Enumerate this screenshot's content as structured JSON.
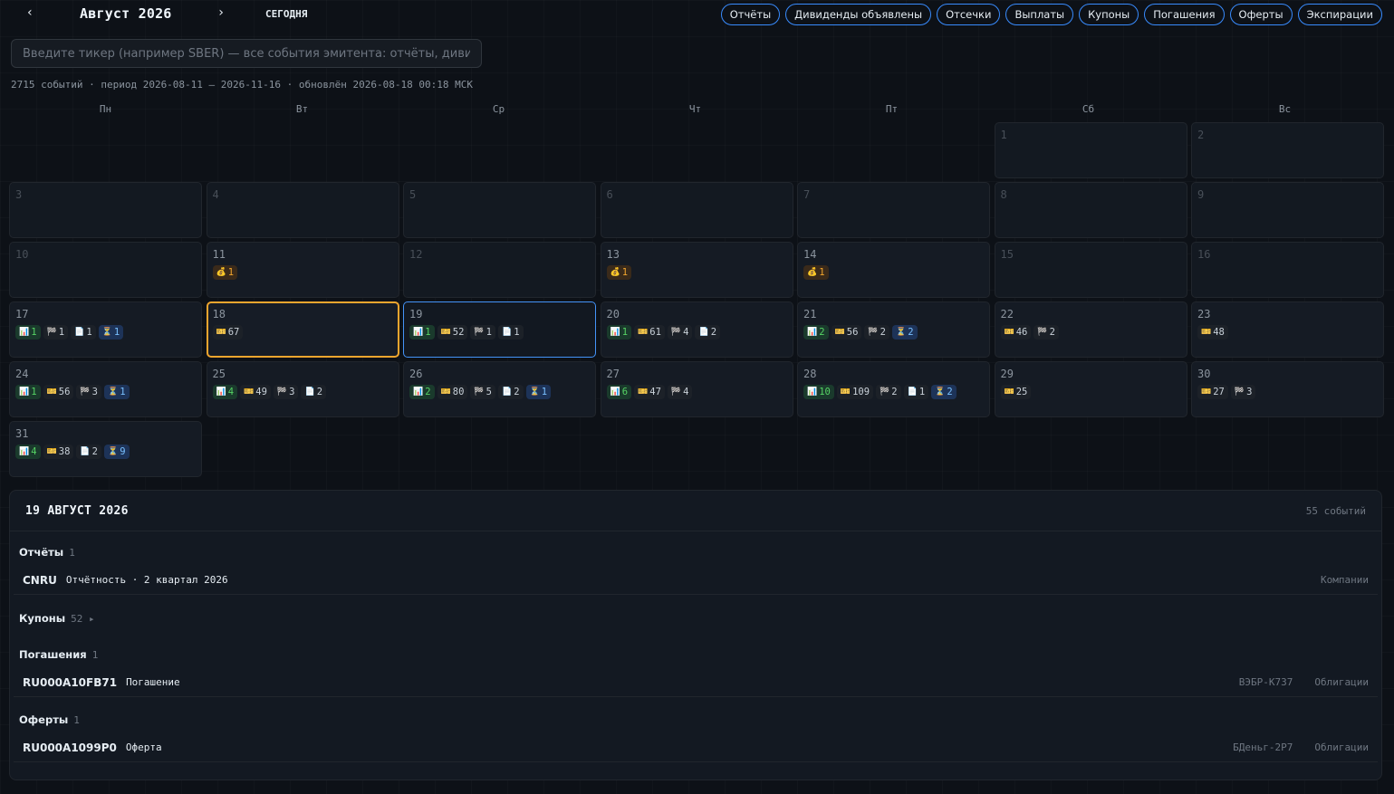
{
  "header": {
    "prev": "‹",
    "next": "›",
    "month": "Август 2026",
    "today": "СЕГОДНЯ"
  },
  "filters": [
    "Отчёты",
    "Дивиденды объявлены",
    "Отсечки",
    "Выплаты",
    "Купоны",
    "Погашения",
    "Оферты",
    "Экспирации"
  ],
  "search": {
    "placeholder": "Введите тикер (например SBER) — все события эмитента: отчёты, дивиденды, купоны",
    "value": ""
  },
  "meta": "2715 событий · период 2026-08-11 — 2026-11-16 · обновлён 2026-08-18 00:18 МСК",
  "weekdays": [
    "Пн",
    "Вт",
    "Ср",
    "Чт",
    "Пт",
    "Сб",
    "Вс"
  ],
  "icons": {
    "reports": "📊",
    "coupons": "🎫",
    "cutoffs": "🏁",
    "redeem": "📄",
    "offers": "⏳",
    "divs": "💰"
  },
  "days": [
    {
      "d": null
    },
    {
      "d": null
    },
    {
      "d": null
    },
    {
      "d": null
    },
    {
      "d": null
    },
    {
      "d": "1",
      "b": []
    },
    {
      "d": "2",
      "b": []
    },
    {
      "d": "3",
      "b": []
    },
    {
      "d": "4",
      "b": []
    },
    {
      "d": "5",
      "b": []
    },
    {
      "d": "6",
      "b": []
    },
    {
      "d": "7",
      "b": []
    },
    {
      "d": "8",
      "b": []
    },
    {
      "d": "9",
      "b": []
    },
    {
      "d": "10",
      "b": []
    },
    {
      "d": "11",
      "b": [
        [
          "divs",
          "1"
        ]
      ]
    },
    {
      "d": "12",
      "b": []
    },
    {
      "d": "13",
      "b": [
        [
          "divs",
          "1"
        ]
      ]
    },
    {
      "d": "14",
      "b": [
        [
          "divs",
          "1"
        ]
      ]
    },
    {
      "d": "15",
      "b": []
    },
    {
      "d": "16",
      "b": []
    },
    {
      "d": "17",
      "b": [
        [
          "reports",
          "1"
        ],
        [
          "cutoffs",
          "1"
        ],
        [
          "redeem",
          "1"
        ],
        [
          "offers",
          "1"
        ]
      ]
    },
    {
      "d": "18",
      "today": true,
      "b": [
        [
          "coupons",
          "67"
        ]
      ]
    },
    {
      "d": "19",
      "selected": true,
      "b": [
        [
          "reports",
          "1"
        ],
        [
          "coupons",
          "52"
        ],
        [
          "cutoffs",
          "1"
        ],
        [
          "redeem",
          "1"
        ]
      ]
    },
    {
      "d": "20",
      "b": [
        [
          "reports",
          "1"
        ],
        [
          "coupons",
          "61"
        ],
        [
          "cutoffs",
          "4"
        ],
        [
          "redeem",
          "2"
        ]
      ]
    },
    {
      "d": "21",
      "b": [
        [
          "reports",
          "2"
        ],
        [
          "coupons",
          "56"
        ],
        [
          "cutoffs",
          "2"
        ],
        [
          "offers",
          "2"
        ]
      ]
    },
    {
      "d": "22",
      "b": [
        [
          "coupons",
          "46"
        ],
        [
          "cutoffs",
          "2"
        ]
      ]
    },
    {
      "d": "23",
      "b": [
        [
          "coupons",
          "48"
        ]
      ]
    },
    {
      "d": "24",
      "b": [
        [
          "reports",
          "1"
        ],
        [
          "coupons",
          "56"
        ],
        [
          "cutoffs",
          "3"
        ],
        [
          "offers",
          "1"
        ]
      ]
    },
    {
      "d": "25",
      "b": [
        [
          "reports",
          "4"
        ],
        [
          "coupons",
          "49"
        ],
        [
          "cutoffs",
          "3"
        ],
        [
          "redeem",
          "2"
        ]
      ]
    },
    {
      "d": "26",
      "b": [
        [
          "reports",
          "2"
        ],
        [
          "coupons",
          "80"
        ],
        [
          "cutoffs",
          "5"
        ],
        [
          "redeem",
          "2"
        ],
        [
          "offers",
          "1"
        ]
      ]
    },
    {
      "d": "27",
      "b": [
        [
          "reports",
          "6"
        ],
        [
          "coupons",
          "47"
        ],
        [
          "cutoffs",
          "4"
        ]
      ]
    },
    {
      "d": "28",
      "b": [
        [
          "reports",
          "10"
        ],
        [
          "coupons",
          "109"
        ],
        [
          "cutoffs",
          "2"
        ],
        [
          "redeem",
          "1"
        ],
        [
          "offers",
          "2"
        ]
      ]
    },
    {
      "d": "29",
      "b": [
        [
          "coupons",
          "25"
        ]
      ]
    },
    {
      "d": "30",
      "b": [
        [
          "coupons",
          "27"
        ],
        [
          "cutoffs",
          "3"
        ]
      ]
    },
    {
      "d": "31",
      "b": [
        [
          "reports",
          "4"
        ],
        [
          "coupons",
          "38"
        ],
        [
          "redeem",
          "2"
        ],
        [
          "offers",
          "9"
        ]
      ]
    }
  ],
  "panel": {
    "title": "19 АВГУСТ 2026",
    "count": "55 событий",
    "reports": {
      "title": "Отчёты",
      "count": "1",
      "ticker": "CNRU",
      "text": "Отчётность · 2 квартал 2026",
      "right": "Компании"
    },
    "coupons": {
      "title": "Купоны",
      "count": "52 ▸"
    },
    "redeem": {
      "title": "Погашения",
      "count": "1",
      "ticker": "RU000A10FB71",
      "text": "Погашение",
      "bond": "ВЭБР-К737",
      "right": "Облигации"
    },
    "offers": {
      "title": "Оферты",
      "count": "1",
      "ticker": "RU000A1099P0",
      "text": "Оферта",
      "bond": "БДеньг-2Р7",
      "right": "Облигации"
    }
  }
}
